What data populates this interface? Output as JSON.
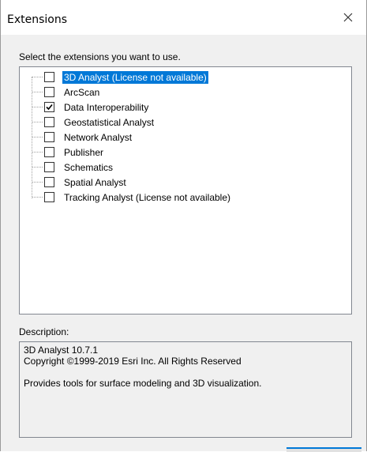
{
  "window": {
    "title": "Extensions"
  },
  "prompt": "Select the extensions you want to use.",
  "extensions": [
    {
      "label": "3D Analyst (License not available)",
      "checked": false,
      "selected": true
    },
    {
      "label": "ArcScan",
      "checked": false,
      "selected": false
    },
    {
      "label": "Data Interoperability",
      "checked": true,
      "selected": false
    },
    {
      "label": "Geostatistical Analyst",
      "checked": false,
      "selected": false
    },
    {
      "label": "Network Analyst",
      "checked": false,
      "selected": false
    },
    {
      "label": "Publisher",
      "checked": false,
      "selected": false
    },
    {
      "label": "Schematics",
      "checked": false,
      "selected": false
    },
    {
      "label": "Spatial Analyst",
      "checked": false,
      "selected": false
    },
    {
      "label": "Tracking Analyst (License not available)",
      "checked": false,
      "selected": false
    }
  ],
  "description": {
    "label": "Description:",
    "line1": "3D Analyst 10.7.1",
    "line2": "Copyright ©1999-2019 Esri Inc. All Rights Reserved",
    "line3": "Provides tools for surface modeling and 3D visualization."
  },
  "colors": {
    "selection": "#0078d7",
    "dialog_bg": "#f0f0f0"
  },
  "icons": {
    "close": "close-icon",
    "check": "checkmark-icon"
  }
}
